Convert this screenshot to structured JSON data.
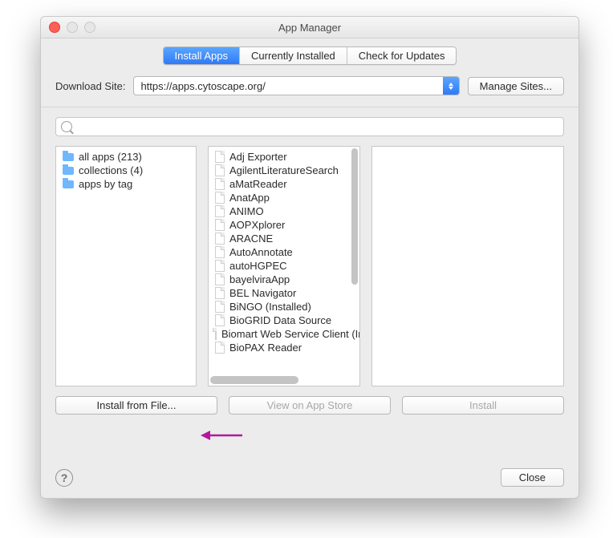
{
  "window": {
    "title": "App Manager"
  },
  "tabs": {
    "install": "Install Apps",
    "installed": "Currently Installed",
    "updates": "Check for Updates"
  },
  "site": {
    "label": "Download Site:",
    "url": "https://apps.cytoscape.org/",
    "manage": "Manage Sites..."
  },
  "search": {
    "placeholder": ""
  },
  "categories": [
    {
      "label": "all apps (213)"
    },
    {
      "label": "collections (4)"
    },
    {
      "label": "apps by tag"
    }
  ],
  "apps": [
    "Adj Exporter",
    "AgilentLiteratureSearch",
    "aMatReader",
    "AnatApp",
    "ANIMO",
    "AOPXplorer",
    "ARACNE",
    "AutoAnnotate",
    "autoHGPEC",
    "bayelviraApp",
    "BEL Navigator",
    "BiNGO (Installed)",
    "BioGRID Data Source",
    "Biomart Web Service Client (Installed)",
    "BioPAX Reader"
  ],
  "buttons": {
    "install_from_file": "Install from File...",
    "view_store": "View on App Store",
    "install": "Install",
    "close": "Close"
  }
}
